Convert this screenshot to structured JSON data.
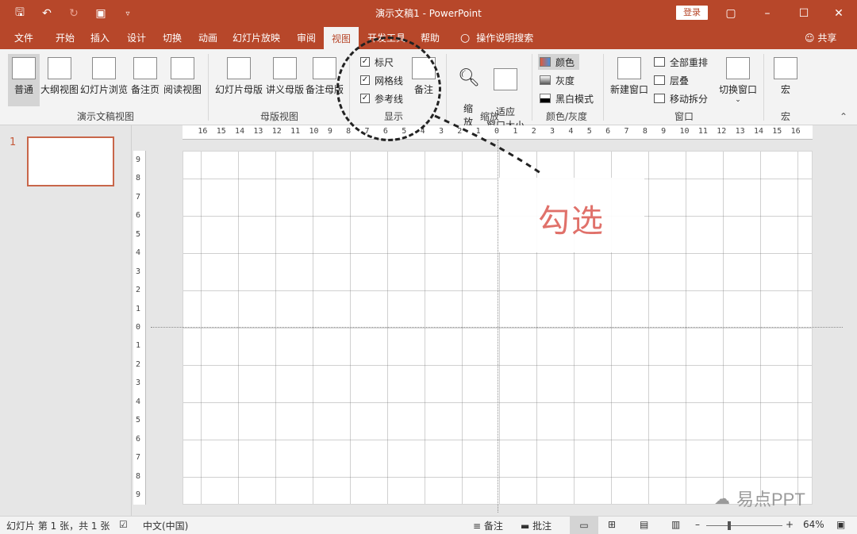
{
  "window": {
    "title": "演示文稿1 - PowerPoint",
    "login_label": "登录",
    "qat": [
      "save-icon",
      "undo-icon",
      "redo-icon",
      "presentation-icon",
      "customize-icon"
    ],
    "controls": [
      "ribbon-options-icon",
      "minimize-icon",
      "maximize-icon",
      "close-icon"
    ]
  },
  "tabs": [
    {
      "label": "文件"
    },
    {
      "label": "开始"
    },
    {
      "label": "插入"
    },
    {
      "label": "设计"
    },
    {
      "label": "切换"
    },
    {
      "label": "动画"
    },
    {
      "label": "幻灯片放映"
    },
    {
      "label": "审阅"
    },
    {
      "label": "视图",
      "active": true
    },
    {
      "label": "开发工具"
    },
    {
      "label": "帮助"
    }
  ],
  "tellme": "操作说明搜索",
  "share": "共享",
  "ribbon": {
    "presentation_views": {
      "label": "演示文稿视图",
      "buttons": [
        "普通",
        "大纲视图",
        "幻灯片浏览",
        "备注页",
        "阅读视图"
      ]
    },
    "master_views": {
      "label": "母版视图",
      "buttons": [
        "幻灯片母版",
        "讲义母版",
        "备注母版"
      ]
    },
    "show": {
      "label": "显示",
      "checks": [
        {
          "label": "标尺",
          "checked": true
        },
        {
          "label": "网格线",
          "checked": true
        },
        {
          "label": "参考线",
          "checked": true
        }
      ],
      "notes_button": "备注"
    },
    "zoom": {
      "label": "缩放",
      "zoom_button": "缩\n放",
      "fit_button": "适应\n窗口大小"
    },
    "color": {
      "label": "颜色/灰度",
      "items": [
        {
          "label": "颜色",
          "color": "#e05a3a",
          "selected": true
        },
        {
          "label": "灰度",
          "color": "#808080"
        },
        {
          "label": "黑白模式",
          "color": "#000000"
        }
      ]
    },
    "window": {
      "label": "窗口",
      "new_window": "新建窗口",
      "items": [
        "全部重排",
        "层叠",
        "移动拆分"
      ],
      "switch_window": "切换窗口"
    },
    "macros": {
      "label": "宏",
      "button": "宏"
    }
  },
  "ruler": {
    "h_labels": [
      "16",
      "15",
      "14",
      "13",
      "12",
      "11",
      "10",
      "9",
      "8",
      "7",
      "6",
      "5",
      "4",
      "3",
      "2",
      "1",
      "0",
      "1",
      "2",
      "3",
      "4",
      "5",
      "6",
      "7",
      "8",
      "9",
      "10",
      "11",
      "12",
      "13",
      "14",
      "15",
      "16"
    ],
    "v_labels": [
      "9",
      "8",
      "7",
      "6",
      "5",
      "4",
      "3",
      "2",
      "1",
      "0",
      "1",
      "2",
      "3",
      "4",
      "5",
      "6",
      "7",
      "8",
      "9"
    ]
  },
  "thumbnail": {
    "number": "1"
  },
  "annotation": {
    "text": "勾选"
  },
  "watermark": "易点PPT",
  "status": {
    "slide_info": "幻灯片 第 1 张，共 1 张",
    "language": "中文(中国)",
    "notes": "备注",
    "comments": "批注",
    "zoom": "64%"
  },
  "colors": {
    "accent": "#b7472a",
    "ribbon_bg": "#f3f3f3",
    "annotation": "#e0716a"
  }
}
